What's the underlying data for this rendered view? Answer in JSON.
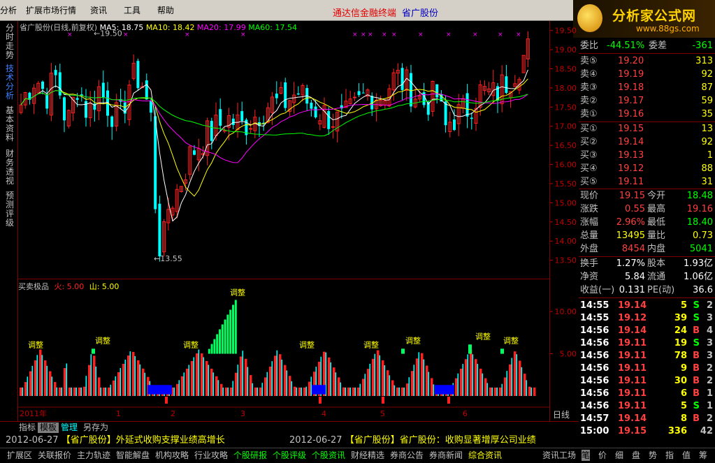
{
  "menubar": {
    "items": [
      "分析",
      "扩展市场行情",
      "资讯",
      "工具",
      "帮助"
    ],
    "app_title": "通达信金融终端",
    "stock_name": "省广股份"
  },
  "logo": {
    "title": "分析家公式网",
    "url_text": "www.88gs.com"
  },
  "sidebar": {
    "tabs": [
      "分时走势",
      "技术分析",
      "基本资料",
      "财务透视",
      "预测评级"
    ]
  },
  "chart": {
    "stock_label": "省广股份(日线,前复权)",
    "ma": [
      {
        "label": "MA5: 18.75",
        "color": "#ffffff"
      },
      {
        "label": "MA10: 18.42",
        "color": "#ffff00"
      },
      {
        "label": "MA20: 17.99",
        "color": "#ff00ff"
      },
      {
        "label": "MA60: 17.54",
        "color": "#00ff00"
      }
    ],
    "high_mark": "19.50",
    "low_mark": "13.55",
    "price_axis": [
      "19.50",
      "19.00",
      "18.50",
      "18.00",
      "17.50",
      "17.00",
      "16.50",
      "16.00",
      "15.50",
      "15.00",
      "14.50",
      "14.00",
      "13.50"
    ],
    "ind_axis": [
      "10.00",
      "5.00"
    ],
    "ind_title": "买卖极品",
    "ind_fire": "火: 5.00",
    "ind_mountain": "山: 5.00",
    "adjust_label": "调整",
    "year_label": "2011年",
    "month_labels": [
      "1",
      "2",
      "3",
      "4",
      "5",
      "6"
    ],
    "period_label": "日线",
    "zoom_controls": "+ - 0"
  },
  "chart_data": {
    "type": "candlestick",
    "title": "省广股份(日线,前复权)",
    "ylim": [
      13.5,
      19.5
    ],
    "high": 19.5,
    "low": 13.55,
    "indicator_ylim": [
      0,
      12
    ]
  },
  "quote": {
    "weibi_label": "委比",
    "weibi": "-44.51%",
    "weicha_label": "委差",
    "weicha": "-361",
    "sell": [
      {
        "label": "卖⑤",
        "price": "19.20",
        "vol": "313"
      },
      {
        "label": "卖④",
        "price": "19.19",
        "vol": "92"
      },
      {
        "label": "卖③",
        "price": "19.18",
        "vol": "87"
      },
      {
        "label": "卖②",
        "price": "19.17",
        "vol": "59"
      },
      {
        "label": "卖①",
        "price": "19.16",
        "vol": "35"
      }
    ],
    "buy": [
      {
        "label": "买①",
        "price": "19.15",
        "vol": "13"
      },
      {
        "label": "买②",
        "price": "19.14",
        "vol": "92"
      },
      {
        "label": "买③",
        "price": "19.13",
        "vol": "1"
      },
      {
        "label": "买④",
        "price": "19.12",
        "vol": "88"
      },
      {
        "label": "买⑤",
        "price": "19.11",
        "vol": "31"
      }
    ],
    "stats": [
      {
        "l1": "现价",
        "v1": "19.15",
        "c1": "#ff4040",
        "l2": "今开",
        "v2": "18.48",
        "c2": "#00ff00"
      },
      {
        "l1": "涨跌",
        "v1": "0.55",
        "c1": "#ff4040",
        "l2": "最高",
        "v2": "19.16",
        "c2": "#ff4040"
      },
      {
        "l1": "涨幅",
        "v1": "2.96%",
        "c1": "#ff4040",
        "l2": "最低",
        "v2": "18.40",
        "c2": "#00ff00"
      },
      {
        "l1": "总量",
        "v1": "13495",
        "c1": "#ffff00",
        "l2": "量比",
        "v2": "0.73",
        "c2": "#ffff00"
      },
      {
        "l1": "外盘",
        "v1": "8454",
        "c1": "#ff4040",
        "l2": "内盘",
        "v2": "5041",
        "c2": "#00ff00"
      }
    ],
    "fund": [
      {
        "l1": "换手",
        "v1": "1.27%",
        "l2": "股本",
        "v2": "1.93亿"
      },
      {
        "l1": "净资",
        "v1": "5.84",
        "l2": "流通",
        "v2": "1.06亿"
      },
      {
        "l1": "收益(一)",
        "v1": "0.131",
        "l2": "PE(动)",
        "v2": "36.6"
      }
    ],
    "ticks": [
      {
        "time": "14:55",
        "price": "19.14",
        "vol": "5",
        "bs": "S",
        "n": "2"
      },
      {
        "time": "14:55",
        "price": "19.12",
        "vol": "39",
        "bs": "S",
        "n": "3"
      },
      {
        "time": "14:56",
        "price": "19.14",
        "vol": "24",
        "bs": "B",
        "n": "4"
      },
      {
        "time": "14:56",
        "price": "19.11",
        "vol": "19",
        "bs": "S",
        "n": "3"
      },
      {
        "time": "14:56",
        "price": "19.11",
        "vol": "78",
        "bs": "B",
        "n": "3"
      },
      {
        "time": "14:56",
        "price": "19.11",
        "vol": "9",
        "bs": "B",
        "n": "2"
      },
      {
        "time": "14:56",
        "price": "19.11",
        "vol": "30",
        "bs": "B",
        "n": "2"
      },
      {
        "time": "14:56",
        "price": "19.11",
        "vol": "6",
        "bs": "B",
        "n": "1"
      },
      {
        "time": "14:56",
        "price": "19.11",
        "vol": "5",
        "bs": "S",
        "n": "1"
      },
      {
        "time": "14:57",
        "price": "19.14",
        "vol": "8",
        "bs": "B",
        "n": "2"
      },
      {
        "time": "15:00",
        "price": "19.15",
        "vol": "336",
        "bs": "",
        "n": "42"
      }
    ]
  },
  "bottom_tabs": [
    "指标",
    "模板",
    "管理",
    "另存为"
  ],
  "ticker": {
    "items": [
      {
        "date": "2012-06-27",
        "text": "【省广股份】外延式收购支撑业绩高增长"
      },
      {
        "date": "2012-06-27",
        "text": "【省广股份】省广股份：收购显著增厚公司业绩"
      }
    ]
  },
  "taskbar": {
    "items": [
      "扩展区",
      "关联报价",
      "主力轨迹",
      "智能解盘",
      "机构攻略",
      "行业攻略",
      "个股研报",
      "个股评级",
      "个股资讯",
      "财经精选",
      "券商公告",
      "券商新闻",
      "综合资讯",
      "资讯工场"
    ],
    "right_tabs": [
      "笔",
      "价",
      "细",
      "盘",
      "势",
      "指",
      "值",
      "筹"
    ]
  },
  "colors": {
    "up": "#ff2020",
    "down": "#00ffff",
    "bg": "#000000",
    "grid": "#800000",
    "green_bar": "#00ff60",
    "blue_bar": "#0000ff"
  }
}
